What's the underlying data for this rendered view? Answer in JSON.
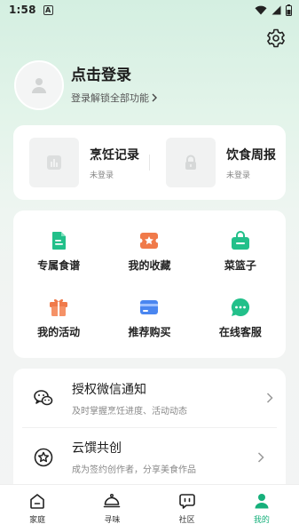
{
  "status_bar": {
    "time": "1:58",
    "notification": "A"
  },
  "profile": {
    "title": "点击登录",
    "subtitle": "登录解锁全部功能"
  },
  "records": [
    {
      "title": "烹饪记录",
      "subtitle": "未登录"
    },
    {
      "title": "饮食周报",
      "subtitle": "未登录"
    }
  ],
  "grid": [
    {
      "label": "专属食谱"
    },
    {
      "label": "我的收藏"
    },
    {
      "label": "菜篮子"
    },
    {
      "label": "我的活动"
    },
    {
      "label": "推荐购买"
    },
    {
      "label": "在线客服"
    }
  ],
  "list": [
    {
      "title": "授权微信通知",
      "subtitle": "及时掌握烹饪进度、活动动态"
    },
    {
      "title": "云馔共创",
      "subtitle": "成为签约创作者，分享美食作品"
    }
  ],
  "tabs": [
    {
      "label": "家庭",
      "icon": "home-icon"
    },
    {
      "label": "寻味",
      "icon": "cloche-icon"
    },
    {
      "label": "社区",
      "icon": "chat-bubble-icon"
    },
    {
      "label": "我的",
      "icon": "person-icon"
    }
  ],
  "colors": {
    "accent": "#16b07b",
    "orange": "#f07a4a",
    "blue": "#4a86f0"
  }
}
